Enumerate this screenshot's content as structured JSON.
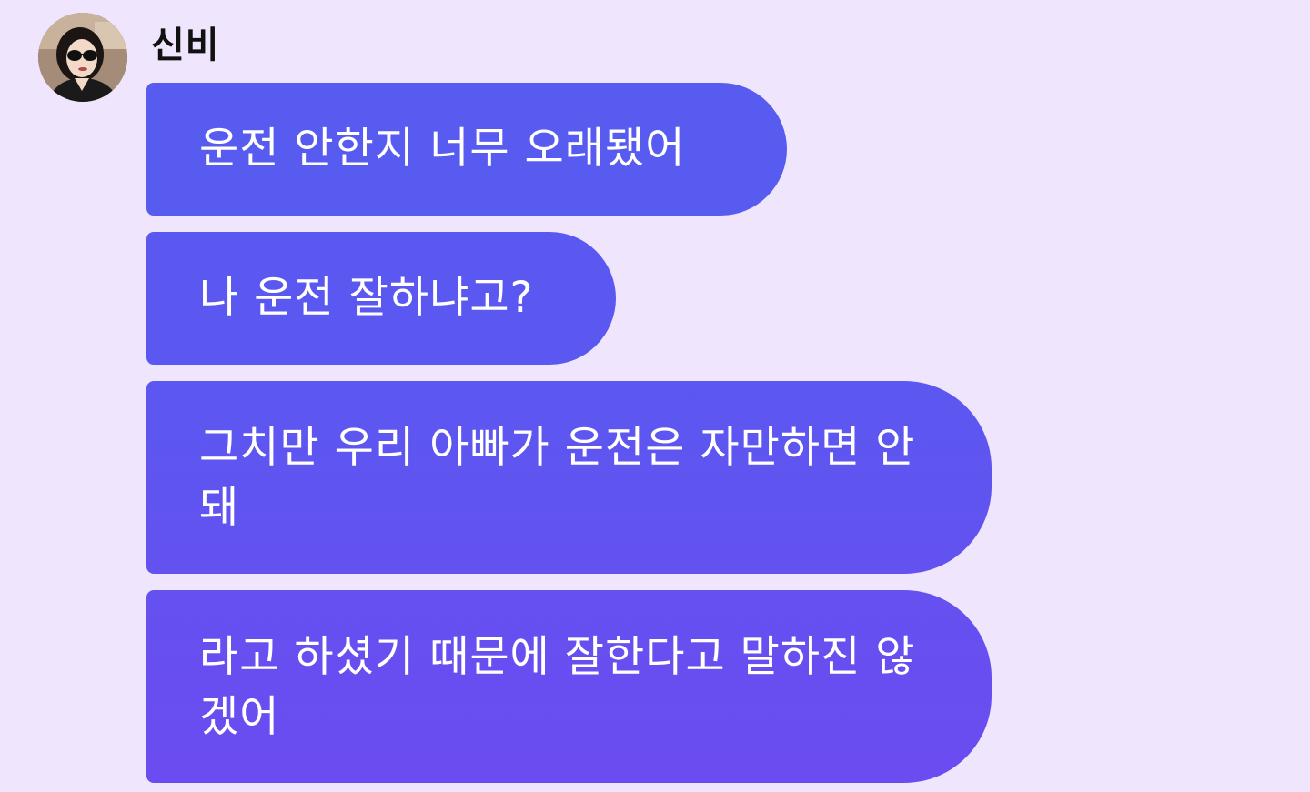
{
  "sender": {
    "name": "신비",
    "avatar_icon": "profile-photo"
  },
  "messages": [
    {
      "text": "운전 안한지 너무 오래됐어"
    },
    {
      "text": "나 운전 잘하냐고?"
    },
    {
      "text": "그치만 우리 아빠가 운전은 자만하면 안돼"
    },
    {
      "text": "라고 하셨기 때문에 잘한다고 말하진 않겠어"
    }
  ],
  "colors": {
    "background": "#EFE6FD",
    "bubble": "#5A58F0",
    "bubble_text": "#FFFFFF",
    "name_text": "#111111"
  }
}
